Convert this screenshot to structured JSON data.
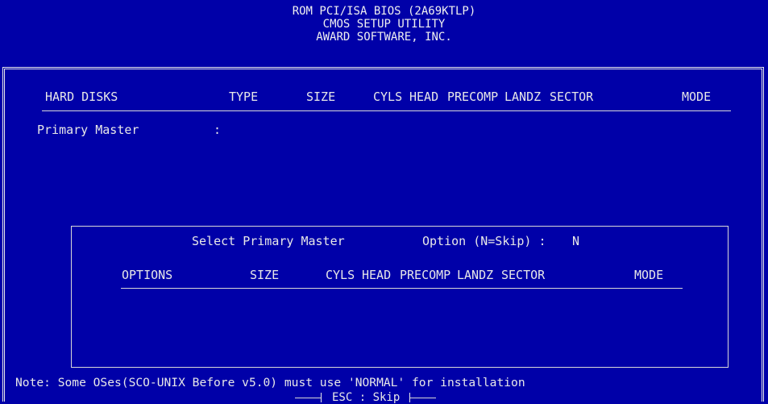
{
  "title": {
    "line1": "ROM PCI/ISA BIOS (2A69KTLP)",
    "line2": "CMOS SETUP UTILITY",
    "line3": "AWARD SOFTWARE, INC."
  },
  "table": {
    "headers": [
      "HARD DISKS",
      "TYPE",
      "SIZE",
      "CYLS",
      "HEAD",
      "PRECOMP",
      "LANDZ",
      "SECTOR",
      "MODE"
    ],
    "row_label": "Primary Master",
    "row_separator": ":"
  },
  "dialog": {
    "prompt": "Select Primary Master",
    "option_text": "Option (N=Skip) :",
    "option_value": "N",
    "headers": [
      "OPTIONS",
      "SIZE",
      "CYLS",
      "HEAD",
      "PRECOMP",
      "LANDZ",
      "SECTOR",
      "MODE"
    ]
  },
  "note": "Note: Some OSes(SCO-UNIX Before v5.0) must use 'NORMAL' for installation",
  "footer": {
    "esc_hint": "ESC : Skip"
  },
  "colors": {
    "background": "#0000a8",
    "foreground": "#e8e8e8"
  }
}
